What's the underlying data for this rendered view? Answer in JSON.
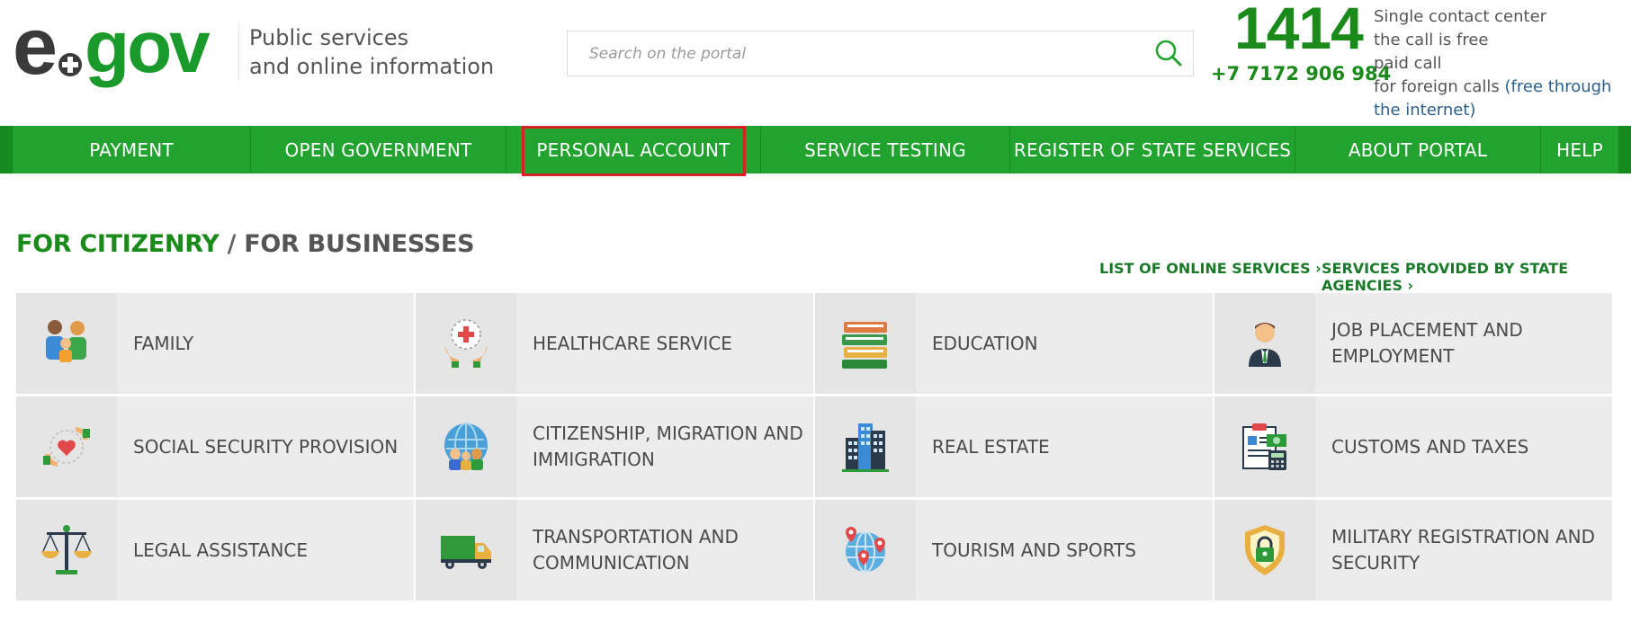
{
  "header": {
    "logo_text": "egov",
    "tagline_line1": "Public services",
    "tagline_line2": "and online information",
    "search_placeholder": "Search on the portal",
    "hotline_number": "1414",
    "hotline_phone": "+7 7172 906 984",
    "contact_line1": "Single contact center",
    "contact_line2": "the call is free",
    "contact_line3": "paid call",
    "contact_line4_prefix": "for foreign calls ",
    "contact_line4_link": "(free through the internet)"
  },
  "nav": {
    "items": [
      {
        "label": "PAYMENT"
      },
      {
        "label": "OPEN GOVERNMENT"
      },
      {
        "label": "PERSONAL ACCOUNT",
        "highlighted": true
      },
      {
        "label": "SERVICE TESTING"
      },
      {
        "label": "REGISTER OF STATE SERVICES"
      },
      {
        "label": "ABOUT PORTAL"
      },
      {
        "label": "HELP"
      }
    ]
  },
  "main": {
    "title_active": "FOR CITIZENRY",
    "title_separator": " / ",
    "title_inactive": "FOR BUSINESSES",
    "link_online_services": "LIST OF ONLINE SERVICES ›",
    "link_state_agencies": "SERVICES PROVIDED BY STATE AGENCIES ›",
    "categories": [
      {
        "label": "FAMILY",
        "icon": "family-icon"
      },
      {
        "label": "HEALTHCARE SERVICE",
        "icon": "healthcare-icon"
      },
      {
        "label": "EDUCATION",
        "icon": "books-icon"
      },
      {
        "label": "JOB PLACEMENT AND EMPLOYMENT",
        "icon": "employee-icon"
      },
      {
        "label": "SOCIAL SECURITY PROVISION",
        "icon": "heart-hands-icon"
      },
      {
        "label": "CITIZENSHIP, MIGRATION AND IMMIGRATION",
        "icon": "globe-people-icon"
      },
      {
        "label": "REAL ESTATE",
        "icon": "buildings-icon"
      },
      {
        "label": "CUSTOMS AND TAXES",
        "icon": "document-money-icon"
      },
      {
        "label": "LEGAL ASSISTANCE",
        "icon": "scales-icon"
      },
      {
        "label": "TRANSPORTATION AND COMMUNICATION",
        "icon": "truck-icon"
      },
      {
        "label": "TOURISM AND SPORTS",
        "icon": "globe-pins-icon"
      },
      {
        "label": "MILITARY REGISTRATION AND SECURITY",
        "icon": "shield-lock-icon"
      }
    ]
  },
  "colors": {
    "brand_green": "#22a22e",
    "dark_green": "#1a8a1a",
    "highlight_red": "#d61f26",
    "tile_bg": "#ececec"
  }
}
